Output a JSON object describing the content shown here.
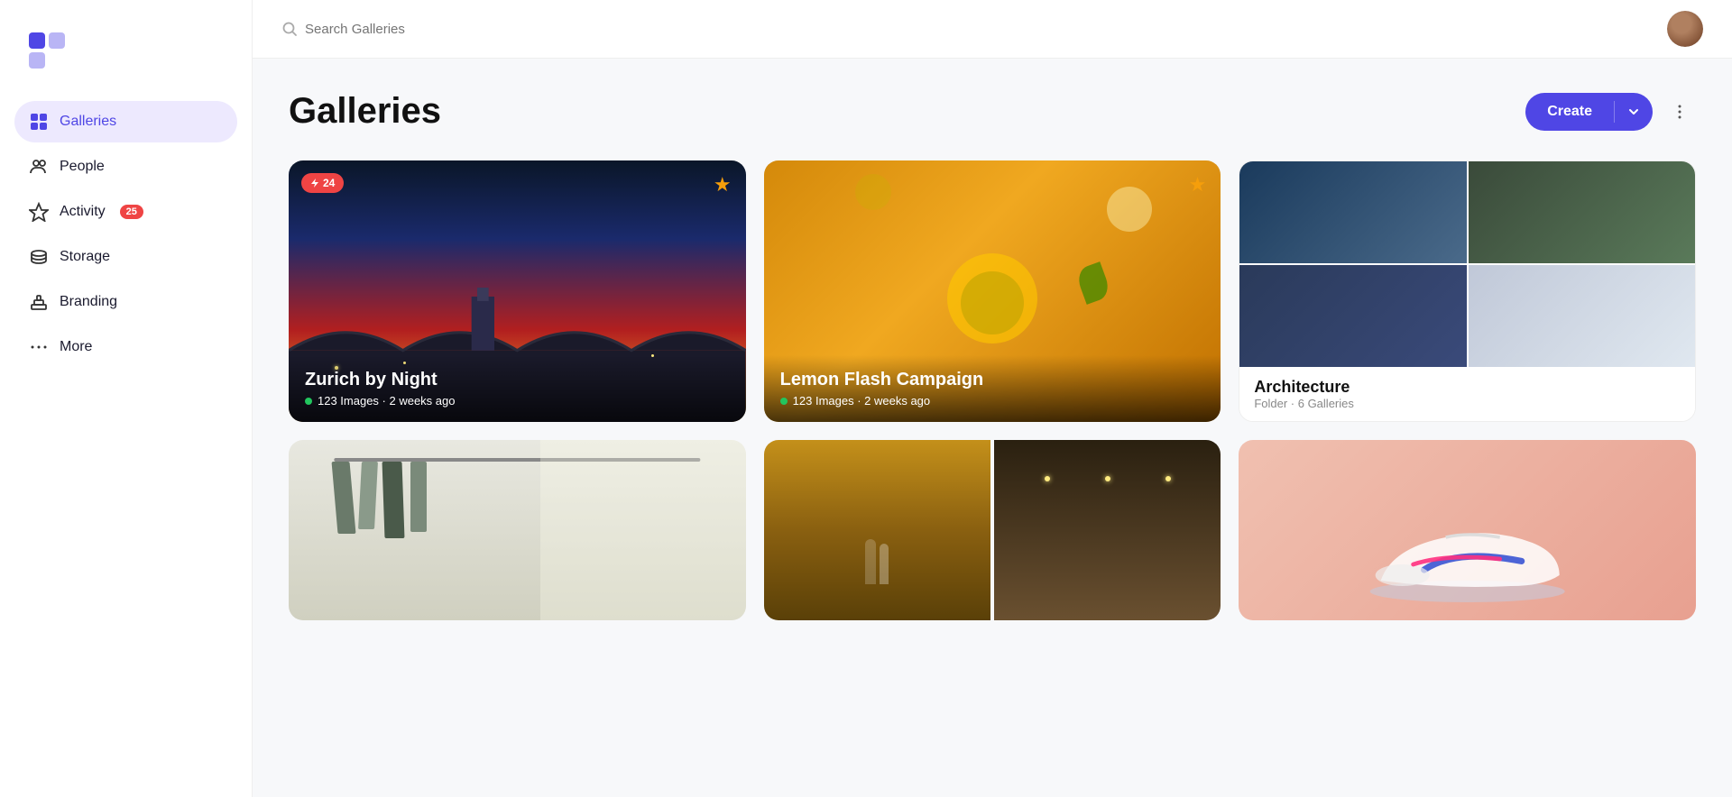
{
  "sidebar": {
    "logo_alt": "App Logo",
    "nav_items": [
      {
        "id": "galleries",
        "label": "Galleries",
        "active": true,
        "badge": null
      },
      {
        "id": "people",
        "label": "People",
        "active": false,
        "badge": null
      },
      {
        "id": "activity",
        "label": "Activity",
        "active": false,
        "badge": "25"
      },
      {
        "id": "storage",
        "label": "Storage",
        "active": false,
        "badge": null
      },
      {
        "id": "branding",
        "label": "Branding",
        "active": false,
        "badge": null
      },
      {
        "id": "more",
        "label": "More",
        "active": false,
        "badge": null
      }
    ]
  },
  "topbar": {
    "search_placeholder": "Search Galleries"
  },
  "main": {
    "page_title": "Galleries",
    "create_label": "Create"
  },
  "galleries": [
    {
      "id": "zurich",
      "title": "Zurich by Night",
      "meta": "123 Images · 2 weeks ago",
      "starred": true,
      "badge": "24",
      "type": "city"
    },
    {
      "id": "lemon",
      "title": "Lemon Flash Campaign",
      "meta": "123 Images · 2 weeks ago",
      "starred": true,
      "badge": null,
      "type": "drink"
    },
    {
      "id": "architecture",
      "title": "Architecture",
      "subtitle": "Folder · 6 Galleries",
      "type": "folder"
    },
    {
      "id": "store",
      "title": "",
      "type": "store"
    },
    {
      "id": "wedding",
      "title": "",
      "type": "wedding"
    },
    {
      "id": "shoe",
      "title": "",
      "type": "shoe"
    }
  ]
}
